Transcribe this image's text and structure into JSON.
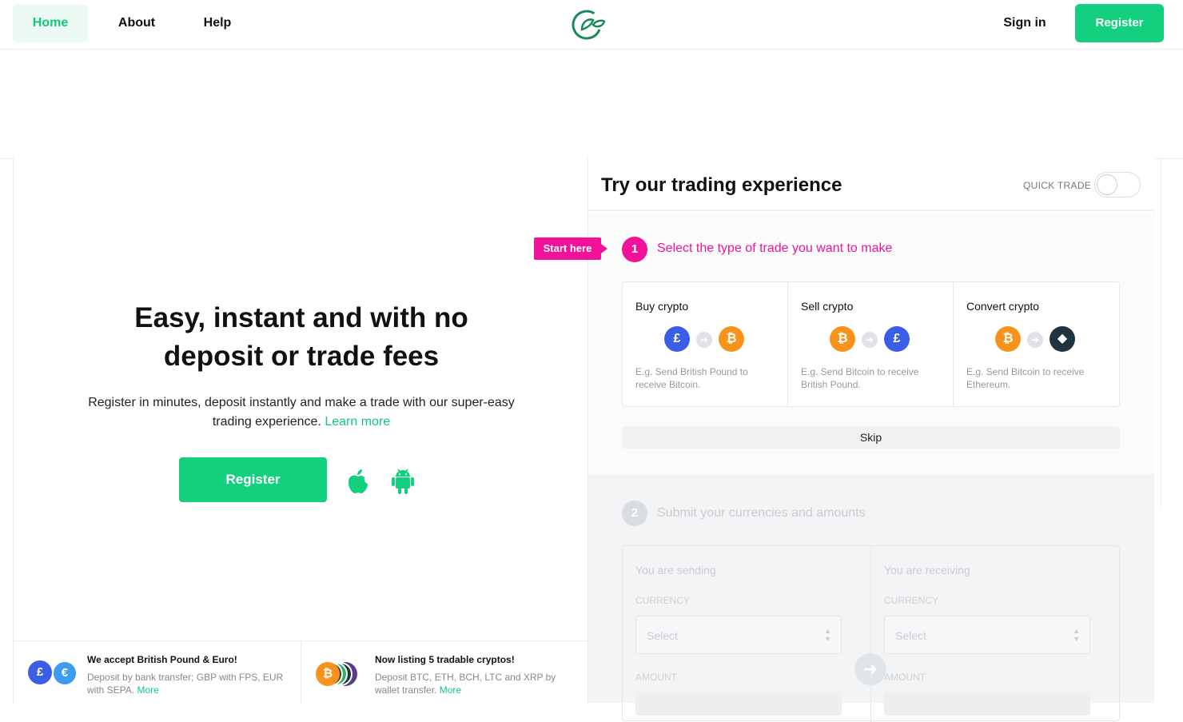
{
  "nav": {
    "home": "Home",
    "about": "About",
    "help": "Help",
    "signin": "Sign in",
    "register": "Register"
  },
  "colors": {
    "brand_green": "#12d07e",
    "accent_pink": "#f0139a"
  },
  "hero": {
    "title_line1": "Easy, instant and with no",
    "title_line2": "deposit or trade fees",
    "subtitle": "Register in minutes, deposit instantly and make a trade with our super-easy trading experience.",
    "learn_more": "Learn more",
    "register": "Register",
    "apple_icon": "apple-icon",
    "android_icon": "android-icon"
  },
  "features": [
    {
      "title": "We accept British Pound & Euro!",
      "desc": "Deposit by bank transfer; GBP with FPS, EUR with SEPA.",
      "more": "More",
      "coins": [
        "£",
        "€"
      ]
    },
    {
      "title": "Now listing 5 tradable cryptos!",
      "desc": "Deposit BTC, ETH, BCH, LTC and XRP by wallet transfer.",
      "more": "More",
      "coins": [
        "₿"
      ]
    }
  ],
  "trading": {
    "title": "Try our trading experience",
    "quick_trade": "QUICK TRADE",
    "quick_trade_on": false,
    "start_here": "Start here",
    "step1": {
      "number": "1",
      "label": "Select the type of trade you want to make"
    },
    "options": [
      {
        "title": "Buy crypto",
        "from": "£",
        "to": "₿",
        "desc": "E.g. Send British Pound to receive Bitcoin."
      },
      {
        "title": "Sell crypto",
        "from": "₿",
        "to": "£",
        "desc": "E.g. Send Bitcoin to receive British Pound."
      },
      {
        "title": "Convert crypto",
        "from": "₿",
        "to": "◆",
        "desc": "E.g. Send Bitcoin to receive Ethereum."
      }
    ],
    "skip": "Skip",
    "step2": {
      "number": "2",
      "label": "Submit your currencies and amounts"
    },
    "sending": {
      "title": "You are sending",
      "currency_label": "CURRENCY",
      "select": "Select",
      "amount_label": "AMOUNT"
    },
    "receiving": {
      "title": "You are receiving",
      "currency_label": "CURRENCY",
      "select": "Select",
      "amount_label": "AMOUNT"
    }
  }
}
